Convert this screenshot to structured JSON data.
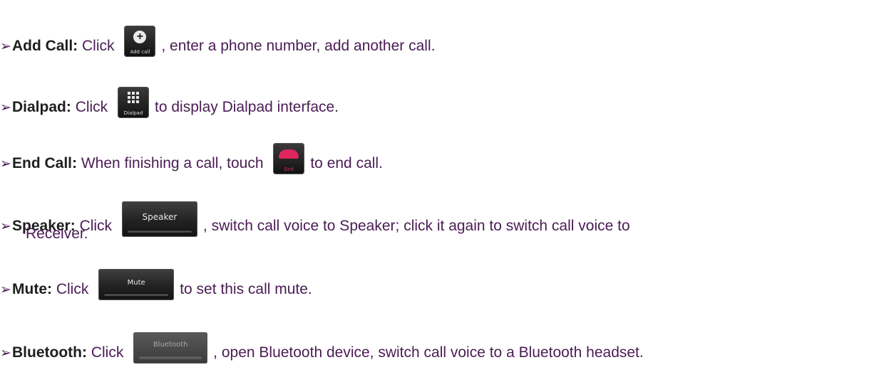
{
  "items": [
    {
      "term": "Add Call:",
      "before": "Click",
      "icon_label": "Add call",
      "icon": "add-call-icon",
      "after": ", enter a phone number, add another call."
    },
    {
      "term": "Dialpad:",
      "before": "Click",
      "icon_label": "Dialpad",
      "icon": "dialpad-icon",
      "after": "to display Dialpad interface."
    },
    {
      "term": "End Call:",
      "before": "When finishing a call, touch",
      "icon_label": "End",
      "icon": "end-call-icon",
      "after": "to end call."
    },
    {
      "term": "Speaker:",
      "before": "Click",
      "icon_label": "Speaker",
      "icon": "speaker-button-icon",
      "after": ", switch call voice to Speaker; click it again to switch call voice to",
      "continuation": "Receiver."
    },
    {
      "term": "Mute:",
      "before": "Click",
      "icon_label": "Mute",
      "icon": "mute-button-icon",
      "after": "to set this call mute."
    },
    {
      "term": "Bluetooth:",
      "before": "Click",
      "icon_label": "Bluetooth",
      "icon": "bluetooth-button-icon",
      "after": ",  open Bluetooth device, switch call voice to a Bluetooth headset."
    }
  ],
  "colors": {
    "term": "#1e1e1e",
    "text": "#4a1c54",
    "end_red": "#e0245e"
  },
  "bullet_icon": "arrow-bullet-icon"
}
